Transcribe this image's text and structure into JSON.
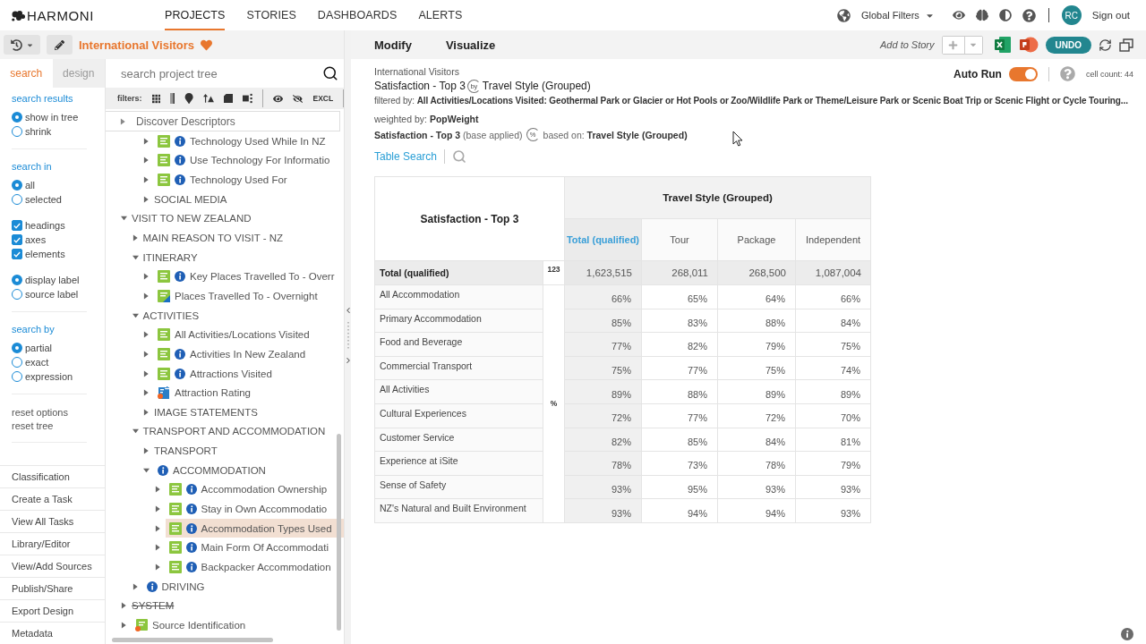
{
  "top_nav": {
    "logo": "HARMONI",
    "items": [
      {
        "label": "PROJECTS",
        "selected": true
      },
      {
        "label": "STORIES",
        "selected": false
      },
      {
        "label": "DASHBOARDS",
        "selected": false
      },
      {
        "label": "ALERTS",
        "selected": false
      }
    ],
    "global_filters": "Global Filters",
    "avatar": "RC",
    "sign_out": "Sign out"
  },
  "project_bar": {
    "title": "International Visitors",
    "favorite": true
  },
  "side_tabs": [
    {
      "label": "search",
      "selected": true
    },
    {
      "label": "design",
      "selected": false
    }
  ],
  "search_options": [
    {
      "heading": "search results",
      "groups": [
        [
          {
            "kind": "radio",
            "label": "show in tree",
            "selected": true
          },
          {
            "kind": "radio",
            "label": "shrink",
            "selected": false
          }
        ]
      ]
    },
    {
      "heading": "search in",
      "groups": [
        [
          {
            "kind": "radio",
            "label": "all",
            "selected": true
          },
          {
            "kind": "radio",
            "label": "selected",
            "selected": false
          }
        ],
        [
          {
            "kind": "checkbox",
            "label": "headings",
            "checked": true
          },
          {
            "kind": "checkbox",
            "label": "axes",
            "checked": true
          },
          {
            "kind": "checkbox",
            "label": "elements",
            "checked": true
          }
        ],
        [
          {
            "kind": "radio",
            "label": "display label",
            "selected": true
          },
          {
            "kind": "radio",
            "label": "source label",
            "selected": false
          }
        ]
      ]
    },
    {
      "heading": "search by",
      "groups": [
        [
          {
            "kind": "radio",
            "label": "partial",
            "selected": true
          },
          {
            "kind": "radio",
            "label": "exact",
            "selected": false
          },
          {
            "kind": "radio",
            "label": "expression",
            "selected": false
          }
        ]
      ]
    },
    {
      "groups": [
        [
          {
            "kind": "link",
            "label": "reset options"
          },
          {
            "kind": "link",
            "label": "reset tree"
          }
        ]
      ]
    }
  ],
  "tools_menu": [
    "Classification",
    "Create a Task",
    "View All Tasks",
    "Library/Editor",
    "View/Add Sources",
    "Publish/Share",
    "Export Design",
    "Metadata"
  ],
  "tree_search": {
    "placeholder": "search project tree"
  },
  "tree_filters": {
    "label": "filters:",
    "exclude": "EXCL"
  },
  "pinned_heading": {
    "label": "Discover Descriptors",
    "expanded": false
  },
  "tree": [
    {
      "children": [
        {
          "children": [
            {
              "label": "Technology Used While In NZ",
              "kind": "variable",
              "info": true,
              "expanded": false,
              "selected": false
            },
            {
              "label": "Use Technology For Informatio",
              "kind": "variable",
              "info": true,
              "expanded": false,
              "selected": false
            },
            {
              "label": "Technology Used For",
              "kind": "variable",
              "info": true,
              "expanded": false,
              "selected": false
            },
            {
              "label": "SOCIAL MEDIA",
              "info": false,
              "expanded": false,
              "selected": false
            }
          ]
        }
      ]
    },
    {
      "label": "VISIT TO NEW ZEALAND",
      "info": false,
      "expanded": true,
      "selected": false,
      "struck": false,
      "children": [
        {
          "label": "MAIN REASON TO VISIT - NZ",
          "info": false,
          "expanded": false,
          "selected": false
        },
        {
          "label": "ITINERARY",
          "info": false,
          "expanded": true,
          "selected": false,
          "children": [
            {
              "label": "Key Places Travelled To - Overr",
              "kind": "variable",
              "info": true,
              "expanded": false,
              "selected": false
            },
            {
              "label": "Places Travelled To - Overnight",
              "kind": "edited_variable",
              "info": false,
              "expanded": false,
              "selected": false
            }
          ]
        },
        {
          "label": "ACTIVITIES",
          "info": false,
          "expanded": true,
          "selected": false,
          "children": [
            {
              "label": "All Activities/Locations Visited",
              "kind": "variable",
              "info": false,
              "expanded": false,
              "selected": false
            },
            {
              "label": "Activities In New Zealand",
              "kind": "variable",
              "info": true,
              "expanded": false,
              "selected": false
            },
            {
              "label": "Attractions Visited",
              "kind": "variable",
              "info": true,
              "expanded": false,
              "selected": false
            },
            {
              "label": "Attraction Rating",
              "kind": "rating",
              "info": false,
              "expanded": false,
              "selected": false
            },
            {
              "label": "IMAGE STATEMENTS",
              "info": false,
              "expanded": false,
              "selected": false
            }
          ]
        },
        {
          "label": "TRANSPORT AND ACCOMMODATION",
          "info": false,
          "expanded": true,
          "selected": false,
          "children": [
            {
              "label": "TRANSPORT",
              "info": false,
              "expanded": false,
              "selected": false
            },
            {
              "label": "ACCOMMODATION",
              "info": true,
              "expanded": true,
              "selected": false,
              "children": [
                {
                  "label": "Accommodation Ownership",
                  "kind": "variable",
                  "info": true,
                  "expanded": false,
                  "selected": false
                },
                {
                  "label": "Stay in Own Accommodatio",
                  "kind": "variable",
                  "info": true,
                  "expanded": false,
                  "selected": false
                },
                {
                  "label": "Accommodation Types Used",
                  "kind": "variable",
                  "info": true,
                  "expanded": false,
                  "selected": true
                },
                {
                  "label": "Main Form Of Accommodati",
                  "kind": "variable",
                  "info": true,
                  "expanded": false,
                  "selected": false
                },
                {
                  "label": "Backpacker Accommodation",
                  "kind": "variable",
                  "info": true,
                  "expanded": false,
                  "selected": false
                }
              ]
            }
          ]
        },
        {
          "label": "DRIVING",
          "info": true,
          "expanded": false,
          "selected": false
        }
      ]
    },
    {
      "label": "SYSTEM",
      "info": false,
      "expanded": false,
      "selected": false,
      "struck": true
    },
    {
      "label": "Source Identification",
      "kind": "source",
      "info": false,
      "expanded": false,
      "selected": false,
      "struck": false
    }
  ],
  "report_toolbar": {
    "menus": [
      "Modify",
      "Visualize"
    ],
    "add_to_story": "Add to Story",
    "undo": "UNDO"
  },
  "report": {
    "project": "International Visitors",
    "row_variable": "Satisfaction - Top 3",
    "connector": "by",
    "column_variable": "Travel Style (Grouped)",
    "filter_label": "filtered by:",
    "filter": "All Activities/Locations Visited: Geothermal Park or Glacier or Hot Pools or Zoo/Wildlife Park or Theme/Leisure Park or Scenic Boat Trip or Scenic Flight or Cycle Touring...",
    "weight_label": "weighted by:",
    "weight": "PopWeight",
    "base_variable": "Satisfaction - Top 3",
    "base_note": "(base applied)",
    "base_badge": "%",
    "based_on_label": "based on:",
    "based_on": "Travel Style (Grouped)",
    "table_search": "Table Search"
  },
  "auto_run": {
    "label": "Auto Run",
    "on": true
  },
  "cell_count": "cell count: 44",
  "table": {
    "corner": "Satisfaction - Top 3",
    "group": "Travel Style (Grouped)",
    "columns": [
      {
        "label": "Total (qualified)",
        "kind": "total"
      },
      {
        "label": "Tour",
        "kind": "group"
      },
      {
        "label": "Package",
        "kind": "group"
      },
      {
        "label": "Independent",
        "kind": "group"
      }
    ],
    "total_row": {
      "label": "Total (qualified)",
      "stat": "123",
      "values": [
        "1,623,515",
        "268,011",
        "268,500",
        "1,087,004"
      ]
    },
    "stat": "%",
    "rows": [
      {
        "label": "All Accommodation",
        "values": [
          "66%",
          "65%",
          "64%",
          "66%"
        ]
      },
      {
        "label": "Primary Accommodation",
        "values": [
          "85%",
          "83%",
          "88%",
          "84%"
        ]
      },
      {
        "label": "Food and Beverage",
        "values": [
          "77%",
          "82%",
          "79%",
          "75%"
        ]
      },
      {
        "label": "Commercial Transport",
        "values": [
          "75%",
          "77%",
          "75%",
          "74%"
        ]
      },
      {
        "label": "All Activities",
        "values": [
          "89%",
          "88%",
          "89%",
          "89%"
        ]
      },
      {
        "label": "Cultural Experiences",
        "values": [
          "72%",
          "77%",
          "72%",
          "70%"
        ]
      },
      {
        "label": "Customer Service",
        "values": [
          "82%",
          "85%",
          "84%",
          "81%"
        ]
      },
      {
        "label": "Experience at iSite",
        "values": [
          "78%",
          "73%",
          "78%",
          "79%"
        ]
      },
      {
        "label": "Sense of Safety",
        "values": [
          "93%",
          "95%",
          "93%",
          "93%"
        ]
      },
      {
        "label": "NZ's Natural and Built Environment",
        "values": [
          "93%",
          "94%",
          "94%",
          "93%"
        ]
      }
    ]
  }
}
